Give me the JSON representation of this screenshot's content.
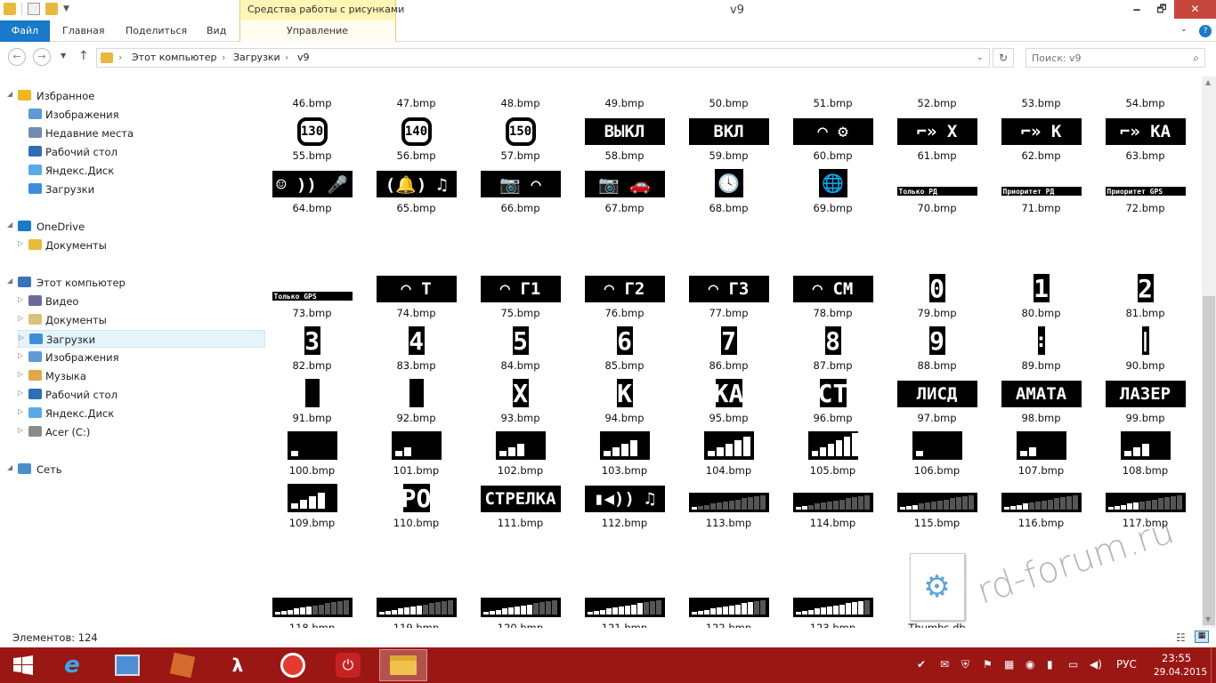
{
  "window": {
    "title": "v9",
    "context_header": "Средства работы с рисунками",
    "minimize": "🗕",
    "maximize": "🗗",
    "close": "✕"
  },
  "ribbon": {
    "tabs": [
      "Файл",
      "Главная",
      "Поделиться",
      "Вид",
      "Управление"
    ],
    "help_icon": "?"
  },
  "address": {
    "breadcrumb": [
      "Этот компьютер",
      "Загрузки",
      "v9"
    ],
    "separator": "›",
    "search_placeholder": "Поиск: v9"
  },
  "nav": {
    "items": [
      {
        "label": "Избранное",
        "icon": "star-icon",
        "level": 0,
        "group": true
      },
      {
        "label": "Изображения",
        "icon": "pictures-icon",
        "level": 1
      },
      {
        "label": "Недавние места",
        "icon": "recent-places-icon",
        "level": 1
      },
      {
        "label": "Рабочий стол",
        "icon": "desktop-icon",
        "level": 1
      },
      {
        "label": "Яндекс.Диск",
        "icon": "cloud-icon",
        "level": 1
      },
      {
        "label": "Загрузки",
        "icon": "downloads-icon",
        "level": 1
      },
      {
        "label": "OneDrive",
        "icon": "onedrive-icon",
        "level": 0,
        "group": true
      },
      {
        "label": "Документы",
        "icon": "folder-icon",
        "level": 1
      },
      {
        "label": "Этот компьютер",
        "icon": "computer-icon",
        "level": 0,
        "group": true
      },
      {
        "label": "Видео",
        "icon": "video-icon",
        "level": 1
      },
      {
        "label": "Документы",
        "icon": "documents-icon",
        "level": 1
      },
      {
        "label": "Загрузки",
        "icon": "downloads-icon",
        "level": 1,
        "selected": true
      },
      {
        "label": "Изображения",
        "icon": "pictures-icon",
        "level": 1
      },
      {
        "label": "Музыка",
        "icon": "music-icon",
        "level": 1
      },
      {
        "label": "Рабочий стол",
        "icon": "desktop-icon",
        "level": 1
      },
      {
        "label": "Яндекс.Диск",
        "icon": "cloud-icon",
        "level": 1
      },
      {
        "label": "Acer (C:)",
        "icon": "drive-icon",
        "level": 1
      },
      {
        "label": "Сеть",
        "icon": "network-icon",
        "level": 0,
        "group": true
      }
    ]
  },
  "files": [
    {
      "name": "46.bmp"
    },
    {
      "name": "47.bmp"
    },
    {
      "name": "48.bmp"
    },
    {
      "name": "49.bmp"
    },
    {
      "name": "50.bmp"
    },
    {
      "name": "51.bmp"
    },
    {
      "name": "52.bmp"
    },
    {
      "name": "53.bmp"
    },
    {
      "name": "54.bmp"
    },
    {
      "name": "55.bmp",
      "thumb": "circle",
      "text": "130"
    },
    {
      "name": "56.bmp",
      "thumb": "circle",
      "text": "140"
    },
    {
      "name": "57.bmp",
      "thumb": "circle",
      "text": "150"
    },
    {
      "name": "58.bmp",
      "thumb": "banner",
      "text": "ВЫКЛ"
    },
    {
      "name": "59.bmp",
      "thumb": "banner",
      "text": "ВКЛ"
    },
    {
      "name": "60.bmp",
      "thumb": "banner",
      "text": "◠ ⚙"
    },
    {
      "name": "61.bmp",
      "thumb": "banner",
      "text": "⌐» Х"
    },
    {
      "name": "62.bmp",
      "thumb": "banner",
      "text": "⌐» К"
    },
    {
      "name": "63.bmp",
      "thumb": "banner",
      "text": "⌐» КА"
    },
    {
      "name": "64.bmp",
      "thumb": "banner",
      "text": "☺ )) 🎤"
    },
    {
      "name": "65.bmp",
      "thumb": "banner",
      "text": "(🔔) ♫"
    },
    {
      "name": "66.bmp",
      "thumb": "banner",
      "text": "📷 ◠"
    },
    {
      "name": "67.bmp",
      "thumb": "banner",
      "text": "📷 🚗"
    },
    {
      "name": "68.bmp",
      "thumb": "icon",
      "text": "🕓"
    },
    {
      "name": "69.bmp",
      "thumb": "icon",
      "text": "🌐"
    },
    {
      "name": "70.bmp",
      "thumb": "strip",
      "text": "Только РД"
    },
    {
      "name": "71.bmp",
      "thumb": "strip",
      "text": "Приоритет РД"
    },
    {
      "name": "72.bmp",
      "thumb": "strip",
      "text": "Приоритет GPS"
    },
    {
      "name": "73.bmp",
      "thumb": "strip",
      "text": "Только GPS"
    },
    {
      "name": "74.bmp",
      "thumb": "banner",
      "text": "◠ Т"
    },
    {
      "name": "75.bmp",
      "thumb": "banner",
      "text": "◠ Г1"
    },
    {
      "name": "76.bmp",
      "thumb": "banner",
      "text": "◠ Г2"
    },
    {
      "name": "77.bmp",
      "thumb": "banner",
      "text": "◠ Г3"
    },
    {
      "name": "78.bmp",
      "thumb": "banner",
      "text": "◠ СМ"
    },
    {
      "name": "79.bmp",
      "thumb": "digit",
      "text": "0"
    },
    {
      "name": "80.bmp",
      "thumb": "digit",
      "text": "1"
    },
    {
      "name": "81.bmp",
      "thumb": "digit",
      "text": "2"
    },
    {
      "name": "82.bmp",
      "thumb": "digit",
      "text": "3"
    },
    {
      "name": "83.bmp",
      "thumb": "digit",
      "text": "4"
    },
    {
      "name": "84.bmp",
      "thumb": "digit",
      "text": "5"
    },
    {
      "name": "85.bmp",
      "thumb": "digit",
      "text": "6"
    },
    {
      "name": "86.bmp",
      "thumb": "digit",
      "text": "7"
    },
    {
      "name": "87.bmp",
      "thumb": "digit",
      "text": "8"
    },
    {
      "name": "88.bmp",
      "thumb": "digit",
      "text": "9"
    },
    {
      "name": "89.bmp",
      "thumb": "digit",
      "text": ":"
    },
    {
      "name": "90.bmp",
      "thumb": "digit",
      "text": "|"
    },
    {
      "name": "91.bmp",
      "thumb": "digit",
      "text": ""
    },
    {
      "name": "92.bmp",
      "thumb": "digit",
      "text": ""
    },
    {
      "name": "93.bmp",
      "thumb": "digit",
      "text": "Х"
    },
    {
      "name": "94.bmp",
      "thumb": "digit",
      "text": "К"
    },
    {
      "name": "95.bmp",
      "thumb": "digit",
      "text": "КА"
    },
    {
      "name": "96.bmp",
      "thumb": "digit",
      "text": "СТ"
    },
    {
      "name": "97.bmp",
      "thumb": "banner",
      "text": "ЛИСД"
    },
    {
      "name": "98.bmp",
      "thumb": "banner",
      "text": "АМАТА"
    },
    {
      "name": "99.bmp",
      "thumb": "banner",
      "text": "ЛАЗЕР"
    },
    {
      "name": "100.bmp",
      "thumb": "bars",
      "level": 1
    },
    {
      "name": "101.bmp",
      "thumb": "bars",
      "level": 2
    },
    {
      "name": "102.bmp",
      "thumb": "bars",
      "level": 3
    },
    {
      "name": "103.bmp",
      "thumb": "bars",
      "level": 4
    },
    {
      "name": "104.bmp",
      "thumb": "bars",
      "level": 5
    },
    {
      "name": "105.bmp",
      "thumb": "bars",
      "level": 6
    },
    {
      "name": "106.bmp",
      "thumb": "bars",
      "level": 1
    },
    {
      "name": "107.bmp",
      "thumb": "bars",
      "level": 2
    },
    {
      "name": "108.bmp",
      "thumb": "bars",
      "level": 3
    },
    {
      "name": "109.bmp",
      "thumb": "bars",
      "level": 4
    },
    {
      "name": "110.bmp",
      "thumb": "digit",
      "text": "РО"
    },
    {
      "name": "111.bmp",
      "thumb": "banner",
      "text": "СТРЕЛКА"
    },
    {
      "name": "112.bmp",
      "thumb": "banner",
      "text": "▮◀)) ♫"
    },
    {
      "name": "113.bmp",
      "thumb": "meter",
      "level": 1
    },
    {
      "name": "114.bmp",
      "thumb": "meter",
      "level": 2
    },
    {
      "name": "115.bmp",
      "thumb": "meter",
      "level": 3
    },
    {
      "name": "116.bmp",
      "thumb": "meter",
      "level": 4
    },
    {
      "name": "117.bmp",
      "thumb": "meter",
      "level": 5
    },
    {
      "name": "118.bmp",
      "thumb": "meter",
      "level": 6
    },
    {
      "name": "119.bmp",
      "thumb": "meter",
      "level": 7
    },
    {
      "name": "120.bmp",
      "thumb": "meter",
      "level": 8
    },
    {
      "name": "121.bmp",
      "thumb": "meter",
      "level": 9
    },
    {
      "name": "122.bmp",
      "thumb": "meter",
      "level": 10
    },
    {
      "name": "123.bmp",
      "thumb": "meter",
      "level": 11
    },
    {
      "name": "Thumbs.db",
      "thumb": "db"
    }
  ],
  "status": {
    "items": "Элементов: 124"
  },
  "watermark": "rd-forum.ru",
  "taskbar": {
    "apps": [
      "start-icon",
      "ie-icon",
      "control-panel-icon",
      "office-icon",
      "lambda-icon",
      "yandex-browser-icon",
      "power-app-icon",
      "file-explorer-icon"
    ],
    "lang": "РУС",
    "time": "23:55",
    "date": "29.04.2015"
  },
  "colors": {
    "accent": "#1979ca",
    "taskbar": "#9a1714",
    "context": "#fff6b5",
    "close": "#c7473c"
  }
}
